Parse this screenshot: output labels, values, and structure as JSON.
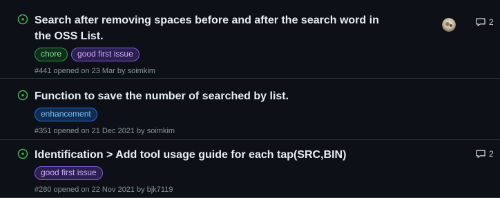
{
  "issues": [
    {
      "title": "Search after removing spaces before and after the search word in the OSS List.",
      "labels": [
        "chore",
        "good first issue"
      ],
      "number": "#441",
      "opened_text": "opened on 23 Mar by",
      "author": "soimkim",
      "comments": "2",
      "has_avatar": true
    },
    {
      "title": "Function to save the number of searched by list.",
      "labels": [
        "enhancement"
      ],
      "number": "#351",
      "opened_text": "opened on 21 Dec 2021 by",
      "author": "soimkim"
    },
    {
      "title": "Identification > Add tool usage guide for each tap(SRC,BIN)",
      "labels": [
        "good first issue"
      ],
      "number": "#280",
      "opened_text": "opened on 22 Nov 2021 by",
      "author": "bjk7119",
      "comments": "2"
    }
  ],
  "colors": {
    "background": "#0d1117",
    "open_icon": "#3fb950",
    "label_chore": "#7ee787",
    "label_good_first_issue": "#d2a8ff",
    "label_enhancement": "#79c0ff"
  },
  "icons": {
    "open": "issue-opened-icon",
    "comment": "comment-icon",
    "avatar": "avatar"
  }
}
